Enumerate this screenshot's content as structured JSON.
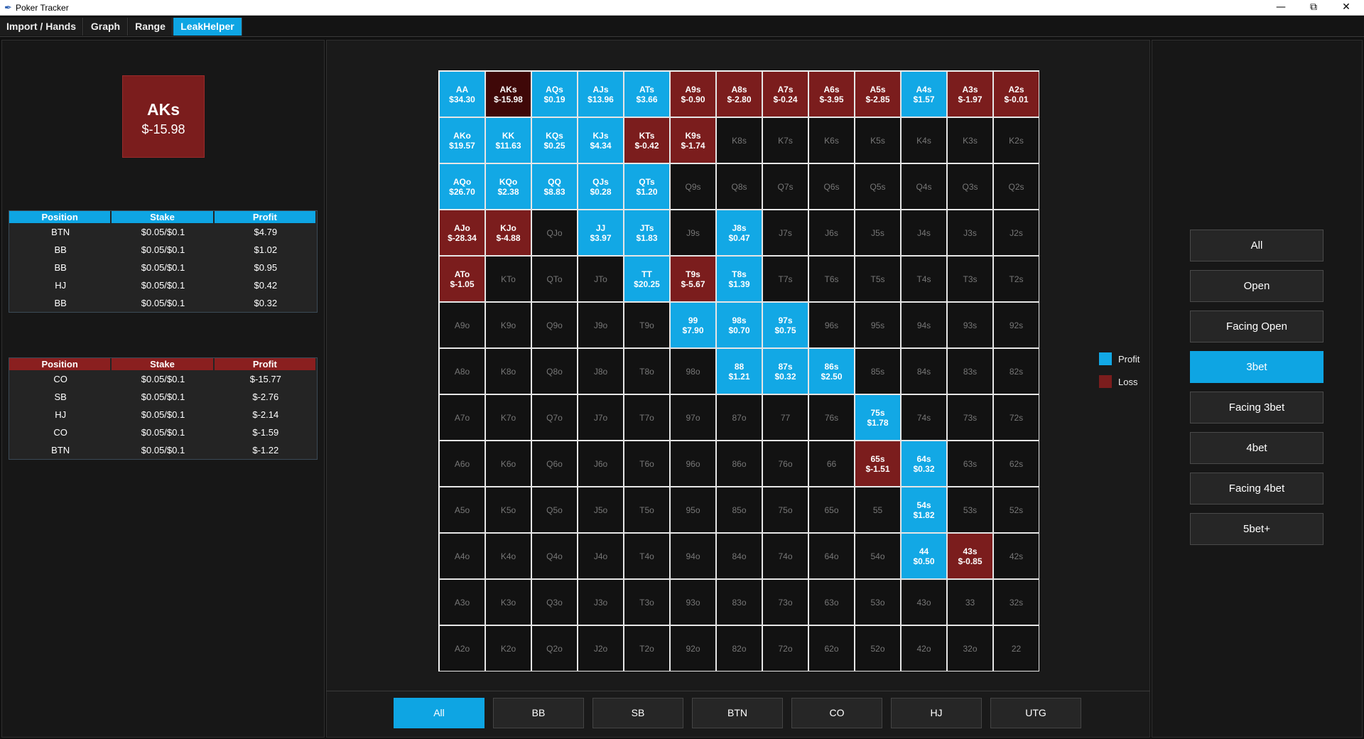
{
  "window": {
    "title": "Poker Tracker",
    "icon": "feather-icon"
  },
  "tabs": [
    {
      "label": "Import / Hands"
    },
    {
      "label": "Graph"
    },
    {
      "label": "Range"
    },
    {
      "label": "LeakHelper"
    }
  ],
  "selected": {
    "hand": "AKs",
    "profit": "$-15.98"
  },
  "profit_table": {
    "headers": [
      "Position",
      "Stake",
      "Profit"
    ],
    "rows": [
      [
        "BTN",
        "$0.05/$0.1",
        "$4.79"
      ],
      [
        "BB",
        "$0.05/$0.1",
        "$1.02"
      ],
      [
        "BB",
        "$0.05/$0.1",
        "$0.95"
      ],
      [
        "HJ",
        "$0.05/$0.1",
        "$0.42"
      ],
      [
        "BB",
        "$0.05/$0.1",
        "$0.32"
      ]
    ]
  },
  "loss_table": {
    "headers": [
      "Position",
      "Stake",
      "Profit"
    ],
    "rows": [
      [
        "CO",
        "$0.05/$0.1",
        "$-15.77"
      ],
      [
        "SB",
        "$0.05/$0.1",
        "$-2.76"
      ],
      [
        "HJ",
        "$0.05/$0.1",
        "$-2.14"
      ],
      [
        "CO",
        "$0.05/$0.1",
        "$-1.59"
      ],
      [
        "BTN",
        "$0.05/$0.1",
        "$-1.22"
      ]
    ]
  },
  "grid": [
    [
      [
        "AA",
        "$34.30",
        "profit"
      ],
      [
        "AKs",
        "$-15.98",
        "selected"
      ],
      [
        "AQs",
        "$0.19",
        "profit"
      ],
      [
        "AJs",
        "$13.96",
        "profit"
      ],
      [
        "ATs",
        "$3.66",
        "profit"
      ],
      [
        "A9s",
        "$-0.90",
        "loss"
      ],
      [
        "A8s",
        "$-2.80",
        "loss"
      ],
      [
        "A7s",
        "$-0.24",
        "loss"
      ],
      [
        "A6s",
        "$-3.95",
        "loss"
      ],
      [
        "A5s",
        "$-2.85",
        "loss"
      ],
      [
        "A4s",
        "$1.57",
        "profit"
      ],
      [
        "A3s",
        "$-1.97",
        "loss"
      ],
      [
        "A2s",
        "$-0.01",
        "loss"
      ]
    ],
    [
      [
        "AKo",
        "$19.57",
        "profit"
      ],
      [
        "KK",
        "$11.63",
        "profit"
      ],
      [
        "KQs",
        "$0.25",
        "profit"
      ],
      [
        "KJs",
        "$4.34",
        "profit"
      ],
      [
        "KTs",
        "$-0.42",
        "loss"
      ],
      [
        "K9s",
        "$-1.74",
        "loss"
      ],
      [
        "K8s",
        "",
        ""
      ],
      [
        "K7s",
        "",
        ""
      ],
      [
        "K6s",
        "",
        ""
      ],
      [
        "K5s",
        "",
        ""
      ],
      [
        "K4s",
        "",
        ""
      ],
      [
        "K3s",
        "",
        ""
      ],
      [
        "K2s",
        "",
        ""
      ]
    ],
    [
      [
        "AQo",
        "$26.70",
        "profit"
      ],
      [
        "KQo",
        "$2.38",
        "profit"
      ],
      [
        "QQ",
        "$8.83",
        "profit"
      ],
      [
        "QJs",
        "$0.28",
        "profit"
      ],
      [
        "QTs",
        "$1.20",
        "profit"
      ],
      [
        "Q9s",
        "",
        ""
      ],
      [
        "Q8s",
        "",
        ""
      ],
      [
        "Q7s",
        "",
        ""
      ],
      [
        "Q6s",
        "",
        ""
      ],
      [
        "Q5s",
        "",
        ""
      ],
      [
        "Q4s",
        "",
        ""
      ],
      [
        "Q3s",
        "",
        ""
      ],
      [
        "Q2s",
        "",
        ""
      ]
    ],
    [
      [
        "AJo",
        "$-28.34",
        "loss"
      ],
      [
        "KJo",
        "$-4.88",
        "loss"
      ],
      [
        "QJo",
        "",
        ""
      ],
      [
        "JJ",
        "$3.97",
        "profit"
      ],
      [
        "JTs",
        "$1.83",
        "profit"
      ],
      [
        "J9s",
        "",
        ""
      ],
      [
        "J8s",
        "$0.47",
        "profit"
      ],
      [
        "J7s",
        "",
        ""
      ],
      [
        "J6s",
        "",
        ""
      ],
      [
        "J5s",
        "",
        ""
      ],
      [
        "J4s",
        "",
        ""
      ],
      [
        "J3s",
        "",
        ""
      ],
      [
        "J2s",
        "",
        ""
      ]
    ],
    [
      [
        "ATo",
        "$-1.05",
        "loss"
      ],
      [
        "KTo",
        "",
        ""
      ],
      [
        "QTo",
        "",
        ""
      ],
      [
        "JTo",
        "",
        ""
      ],
      [
        "TT",
        "$20.25",
        "profit"
      ],
      [
        "T9s",
        "$-5.67",
        "loss"
      ],
      [
        "T8s",
        "$1.39",
        "profit"
      ],
      [
        "T7s",
        "",
        ""
      ],
      [
        "T6s",
        "",
        ""
      ],
      [
        "T5s",
        "",
        ""
      ],
      [
        "T4s",
        "",
        ""
      ],
      [
        "T3s",
        "",
        ""
      ],
      [
        "T2s",
        "",
        ""
      ]
    ],
    [
      [
        "A9o",
        "",
        ""
      ],
      [
        "K9o",
        "",
        ""
      ],
      [
        "Q9o",
        "",
        ""
      ],
      [
        "J9o",
        "",
        ""
      ],
      [
        "T9o",
        "",
        ""
      ],
      [
        "99",
        "$7.90",
        "profit"
      ],
      [
        "98s",
        "$0.70",
        "profit"
      ],
      [
        "97s",
        "$0.75",
        "profit"
      ],
      [
        "96s",
        "",
        ""
      ],
      [
        "95s",
        "",
        ""
      ],
      [
        "94s",
        "",
        ""
      ],
      [
        "93s",
        "",
        ""
      ],
      [
        "92s",
        "",
        ""
      ]
    ],
    [
      [
        "A8o",
        "",
        ""
      ],
      [
        "K8o",
        "",
        ""
      ],
      [
        "Q8o",
        "",
        ""
      ],
      [
        "J8o",
        "",
        ""
      ],
      [
        "T8o",
        "",
        ""
      ],
      [
        "98o",
        "",
        ""
      ],
      [
        "88",
        "$1.21",
        "profit"
      ],
      [
        "87s",
        "$0.32",
        "profit"
      ],
      [
        "86s",
        "$2.50",
        "profit"
      ],
      [
        "85s",
        "",
        ""
      ],
      [
        "84s",
        "",
        ""
      ],
      [
        "83s",
        "",
        ""
      ],
      [
        "82s",
        "",
        ""
      ]
    ],
    [
      [
        "A7o",
        "",
        ""
      ],
      [
        "K7o",
        "",
        ""
      ],
      [
        "Q7o",
        "",
        ""
      ],
      [
        "J7o",
        "",
        ""
      ],
      [
        "T7o",
        "",
        ""
      ],
      [
        "97o",
        "",
        ""
      ],
      [
        "87o",
        "",
        ""
      ],
      [
        "77",
        "",
        ""
      ],
      [
        "76s",
        "",
        ""
      ],
      [
        "75s",
        "$1.78",
        "profit"
      ],
      [
        "74s",
        "",
        ""
      ],
      [
        "73s",
        "",
        ""
      ],
      [
        "72s",
        "",
        ""
      ]
    ],
    [
      [
        "A6o",
        "",
        ""
      ],
      [
        "K6o",
        "",
        ""
      ],
      [
        "Q6o",
        "",
        ""
      ],
      [
        "J6o",
        "",
        ""
      ],
      [
        "T6o",
        "",
        ""
      ],
      [
        "96o",
        "",
        ""
      ],
      [
        "86o",
        "",
        ""
      ],
      [
        "76o",
        "",
        ""
      ],
      [
        "66",
        "",
        ""
      ],
      [
        "65s",
        "$-1.51",
        "loss"
      ],
      [
        "64s",
        "$0.32",
        "profit"
      ],
      [
        "63s",
        "",
        ""
      ],
      [
        "62s",
        "",
        ""
      ]
    ],
    [
      [
        "A5o",
        "",
        ""
      ],
      [
        "K5o",
        "",
        ""
      ],
      [
        "Q5o",
        "",
        ""
      ],
      [
        "J5o",
        "",
        ""
      ],
      [
        "T5o",
        "",
        ""
      ],
      [
        "95o",
        "",
        ""
      ],
      [
        "85o",
        "",
        ""
      ],
      [
        "75o",
        "",
        ""
      ],
      [
        "65o",
        "",
        ""
      ],
      [
        "55",
        "",
        ""
      ],
      [
        "54s",
        "$1.82",
        "profit"
      ],
      [
        "53s",
        "",
        ""
      ],
      [
        "52s",
        "",
        ""
      ]
    ],
    [
      [
        "A4o",
        "",
        ""
      ],
      [
        "K4o",
        "",
        ""
      ],
      [
        "Q4o",
        "",
        ""
      ],
      [
        "J4o",
        "",
        ""
      ],
      [
        "T4o",
        "",
        ""
      ],
      [
        "94o",
        "",
        ""
      ],
      [
        "84o",
        "",
        ""
      ],
      [
        "74o",
        "",
        ""
      ],
      [
        "64o",
        "",
        ""
      ],
      [
        "54o",
        "",
        ""
      ],
      [
        "44",
        "$0.50",
        "profit"
      ],
      [
        "43s",
        "$-0.85",
        "loss"
      ],
      [
        "42s",
        "",
        ""
      ]
    ],
    [
      [
        "A3o",
        "",
        ""
      ],
      [
        "K3o",
        "",
        ""
      ],
      [
        "Q3o",
        "",
        ""
      ],
      [
        "J3o",
        "",
        ""
      ],
      [
        "T3o",
        "",
        ""
      ],
      [
        "93o",
        "",
        ""
      ],
      [
        "83o",
        "",
        ""
      ],
      [
        "73o",
        "",
        ""
      ],
      [
        "63o",
        "",
        ""
      ],
      [
        "53o",
        "",
        ""
      ],
      [
        "43o",
        "",
        ""
      ],
      [
        "33",
        "",
        ""
      ],
      [
        "32s",
        "",
        ""
      ]
    ],
    [
      [
        "A2o",
        "",
        ""
      ],
      [
        "K2o",
        "",
        ""
      ],
      [
        "Q2o",
        "",
        ""
      ],
      [
        "J2o",
        "",
        ""
      ],
      [
        "T2o",
        "",
        ""
      ],
      [
        "92o",
        "",
        ""
      ],
      [
        "82o",
        "",
        ""
      ],
      [
        "72o",
        "",
        ""
      ],
      [
        "62o",
        "",
        ""
      ],
      [
        "52o",
        "",
        ""
      ],
      [
        "42o",
        "",
        ""
      ],
      [
        "32o",
        "",
        ""
      ],
      [
        "22",
        "",
        ""
      ]
    ]
  ],
  "legend": [
    {
      "label": "Profit",
      "color": "#12a8e5"
    },
    {
      "label": "Loss",
      "color": "#7b1d1d"
    }
  ],
  "action_buttons": [
    {
      "label": "All",
      "active": false
    },
    {
      "label": "Open",
      "active": false
    },
    {
      "label": "Facing Open",
      "active": false
    },
    {
      "label": "3bet",
      "active": true
    },
    {
      "label": "Facing 3bet",
      "active": false
    },
    {
      "label": "4bet",
      "active": false
    },
    {
      "label": "Facing 4bet",
      "active": false
    },
    {
      "label": "5bet+",
      "active": false
    }
  ],
  "position_buttons": [
    {
      "label": "All",
      "active": true
    },
    {
      "label": "BB",
      "active": false
    },
    {
      "label": "SB",
      "active": false
    },
    {
      "label": "BTN",
      "active": false
    },
    {
      "label": "CO",
      "active": false
    },
    {
      "label": "HJ",
      "active": false
    },
    {
      "label": "UTG",
      "active": false
    }
  ],
  "colors": {
    "accent": "#0ea5e3",
    "loss": "#7b1d1d",
    "selected": "#3f0808",
    "background": "#111111"
  }
}
